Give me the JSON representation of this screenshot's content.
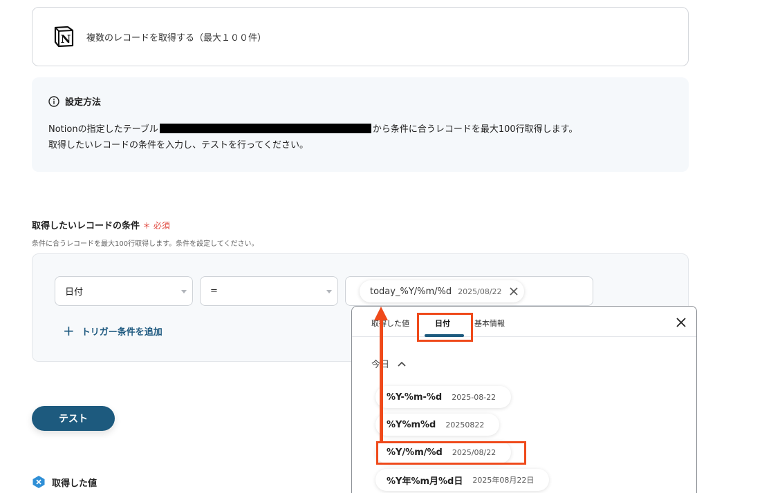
{
  "action": {
    "title": "複数のレコードを取得する（最大１００件）",
    "icon": "notion-logo"
  },
  "howto": {
    "heading": "設定方法",
    "line1_prefix": "Notionの指定したテーブル",
    "line1_suffix": "から条件に合うレコードを最大100行取得します。",
    "line2": "取得したいレコードの条件を入力し、テストを行ってください。"
  },
  "condition": {
    "label": "取得したいレコードの条件",
    "required_mark": "＊ 必須",
    "description": "条件に合うレコードを最大100行取得します。条件を設定してください。",
    "field_select": "日付",
    "operator_select": "=",
    "value_token": {
      "name": "today_%Y/%m/%d",
      "example": "2025/08/22"
    },
    "add_trigger_label": "トリガー条件を追加"
  },
  "test_button_label": "テスト",
  "retrieved_values_label": "取得した値",
  "popup": {
    "tabs": [
      {
        "label": "取得した値",
        "active": false
      },
      {
        "label": "日付",
        "active": true
      },
      {
        "label": "基本情報",
        "active": false
      }
    ],
    "section_label": "今日",
    "formats": [
      {
        "format": "%Y-%m-%d",
        "example": "2025-08-22"
      },
      {
        "format": "%Y%m%d",
        "example": "20250822"
      },
      {
        "format": "%Y/%m/%d",
        "example": "2025/08/22",
        "highlighted": true
      },
      {
        "format": "%Y年%m月%d日",
        "example": "2025年08月22日"
      }
    ]
  },
  "colors": {
    "primary": "#1d5a7e",
    "highlight": "#ef4a1b",
    "required": "#e0483e"
  }
}
